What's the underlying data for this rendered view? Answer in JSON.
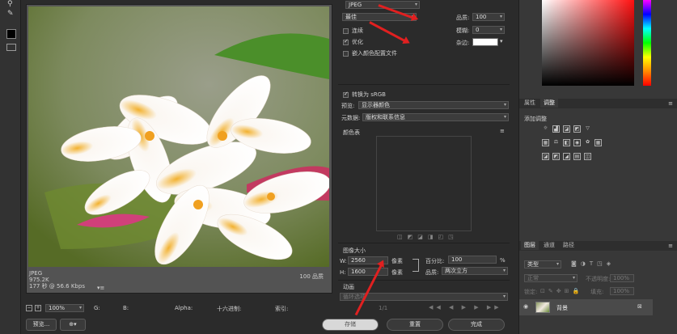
{
  "image_info": {
    "format": "JPEG",
    "size": "975.2K",
    "speed": "177 秒 @ 56.6 Kbps",
    "quality": "100 品质"
  },
  "status_bar": {
    "zoom": "100%",
    "g_label": "G:",
    "b_label": "B:",
    "alpha_label": "Alpha:",
    "hex_label": "十六进制:",
    "index_label": "索引:"
  },
  "buttons": {
    "preview": "预览...",
    "save": "存储",
    "reset": "重置",
    "done": "完成"
  },
  "settings": {
    "format": "JPEG",
    "preset": "最佳",
    "quality_label": "品质:",
    "quality_value": "100",
    "progressive_label": "连续",
    "blur_label": "模糊:",
    "blur_value": "0",
    "optimized_label": "优化",
    "matte_label": "杂边:",
    "embed_profile_label": "嵌入颜色配置文件",
    "convert_srgb_label": "转换为 sRGB",
    "preview_label": "预览:",
    "preview_value": "显示器颜色",
    "metadata_label": "元数据:",
    "metadata_value": "版权和联系信息",
    "color_table_label": "颜色表"
  },
  "image_size": {
    "title": "图像大小",
    "w_label": "W:",
    "w_value": "2560",
    "h_label": "H:",
    "h_value": "1600",
    "unit": "像素",
    "percent_label": "百分比:",
    "percent_value": "100",
    "percent_unit": "%",
    "quality_label": "品质:",
    "quality_value": "两次立方"
  },
  "animation": {
    "title": "动画",
    "loop_label": "循环选项",
    "frame_counter": "1/1"
  },
  "right_panel": {
    "tab_properties": "属性",
    "tab_adjustments": "调整",
    "add_adjustment": "添加调整",
    "tab_layers": "图层",
    "tab_channels": "通道",
    "tab_paths": "路径",
    "kind_label": "类型",
    "blend_mode": "正常",
    "opacity_label": "不透明度:",
    "opacity_value": "100%",
    "lock_label": "锁定:",
    "fill_label": "填充:",
    "fill_value": "100%",
    "layer_name": "背景"
  },
  "colors": {
    "accent_red": "#e02020",
    "bg": "#2b2b2b"
  }
}
